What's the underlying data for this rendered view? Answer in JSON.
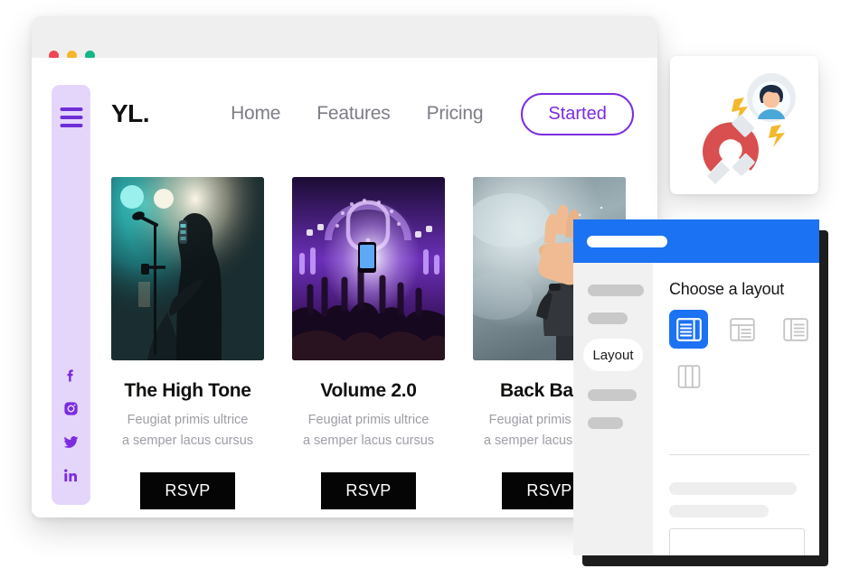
{
  "browser": {
    "traffic_lights": [
      {
        "name": "close",
        "color": "#ee4757"
      },
      {
        "name": "minimize",
        "color": "#f7b52b"
      },
      {
        "name": "maximize",
        "color": "#14b687"
      }
    ],
    "site": {
      "logo": "YL.",
      "nav": [
        {
          "label": "Home"
        },
        {
          "label": "Features"
        },
        {
          "label": "Pricing"
        }
      ],
      "cta_label": "Started",
      "cta_color": "#7b2ce0",
      "rail": {
        "menu_icon": "hamburger-icon",
        "socials": [
          {
            "name": "facebook-icon"
          },
          {
            "name": "instagram-icon"
          },
          {
            "name": "twitter-icon"
          },
          {
            "name": "linkedin-icon"
          }
        ],
        "background": "#e4d6fb"
      },
      "cards": [
        {
          "title": "The High Tone",
          "desc_line1": "Feugiat primis ultrice",
          "desc_line2": "a semper lacus cursus",
          "button": "RSVP",
          "image": "concert-guitarist-teal-stage-photo"
        },
        {
          "title": "Volume 2.0",
          "desc_line1": "Feugiat primis ultrice",
          "desc_line2": "a semper lacus cursus",
          "button": "RSVP",
          "image": "festival-crowd-purple-lights-photo"
        },
        {
          "title": "Back Basic",
          "desc_line1": "Feugiat primis ultrice",
          "desc_line2": "a semper lacus cursus",
          "button": "RSVP",
          "image": "raised-hand-smoke-sky-photo"
        }
      ]
    }
  },
  "magnet_card": {
    "illustration": "lead-magnet-with-user-avatar-illustration",
    "magnet_color": "#e04f4f",
    "spark_color": "#f7b731"
  },
  "modal": {
    "header_color": "#1b72f2",
    "sidebar": {
      "active_item": "Layout",
      "placeholder_count": 4
    },
    "title": "Choose a layout",
    "options": [
      {
        "name": "layout-option-lines-right-sidebar",
        "selected": true
      },
      {
        "name": "layout-option-topbar-sidebar",
        "selected": false
      },
      {
        "name": "layout-option-left-sidebar",
        "selected": false
      },
      {
        "name": "layout-option-three-columns",
        "selected": false
      }
    ],
    "placeholders": {
      "bar1": "",
      "bar2": "",
      "input_value": ""
    }
  }
}
